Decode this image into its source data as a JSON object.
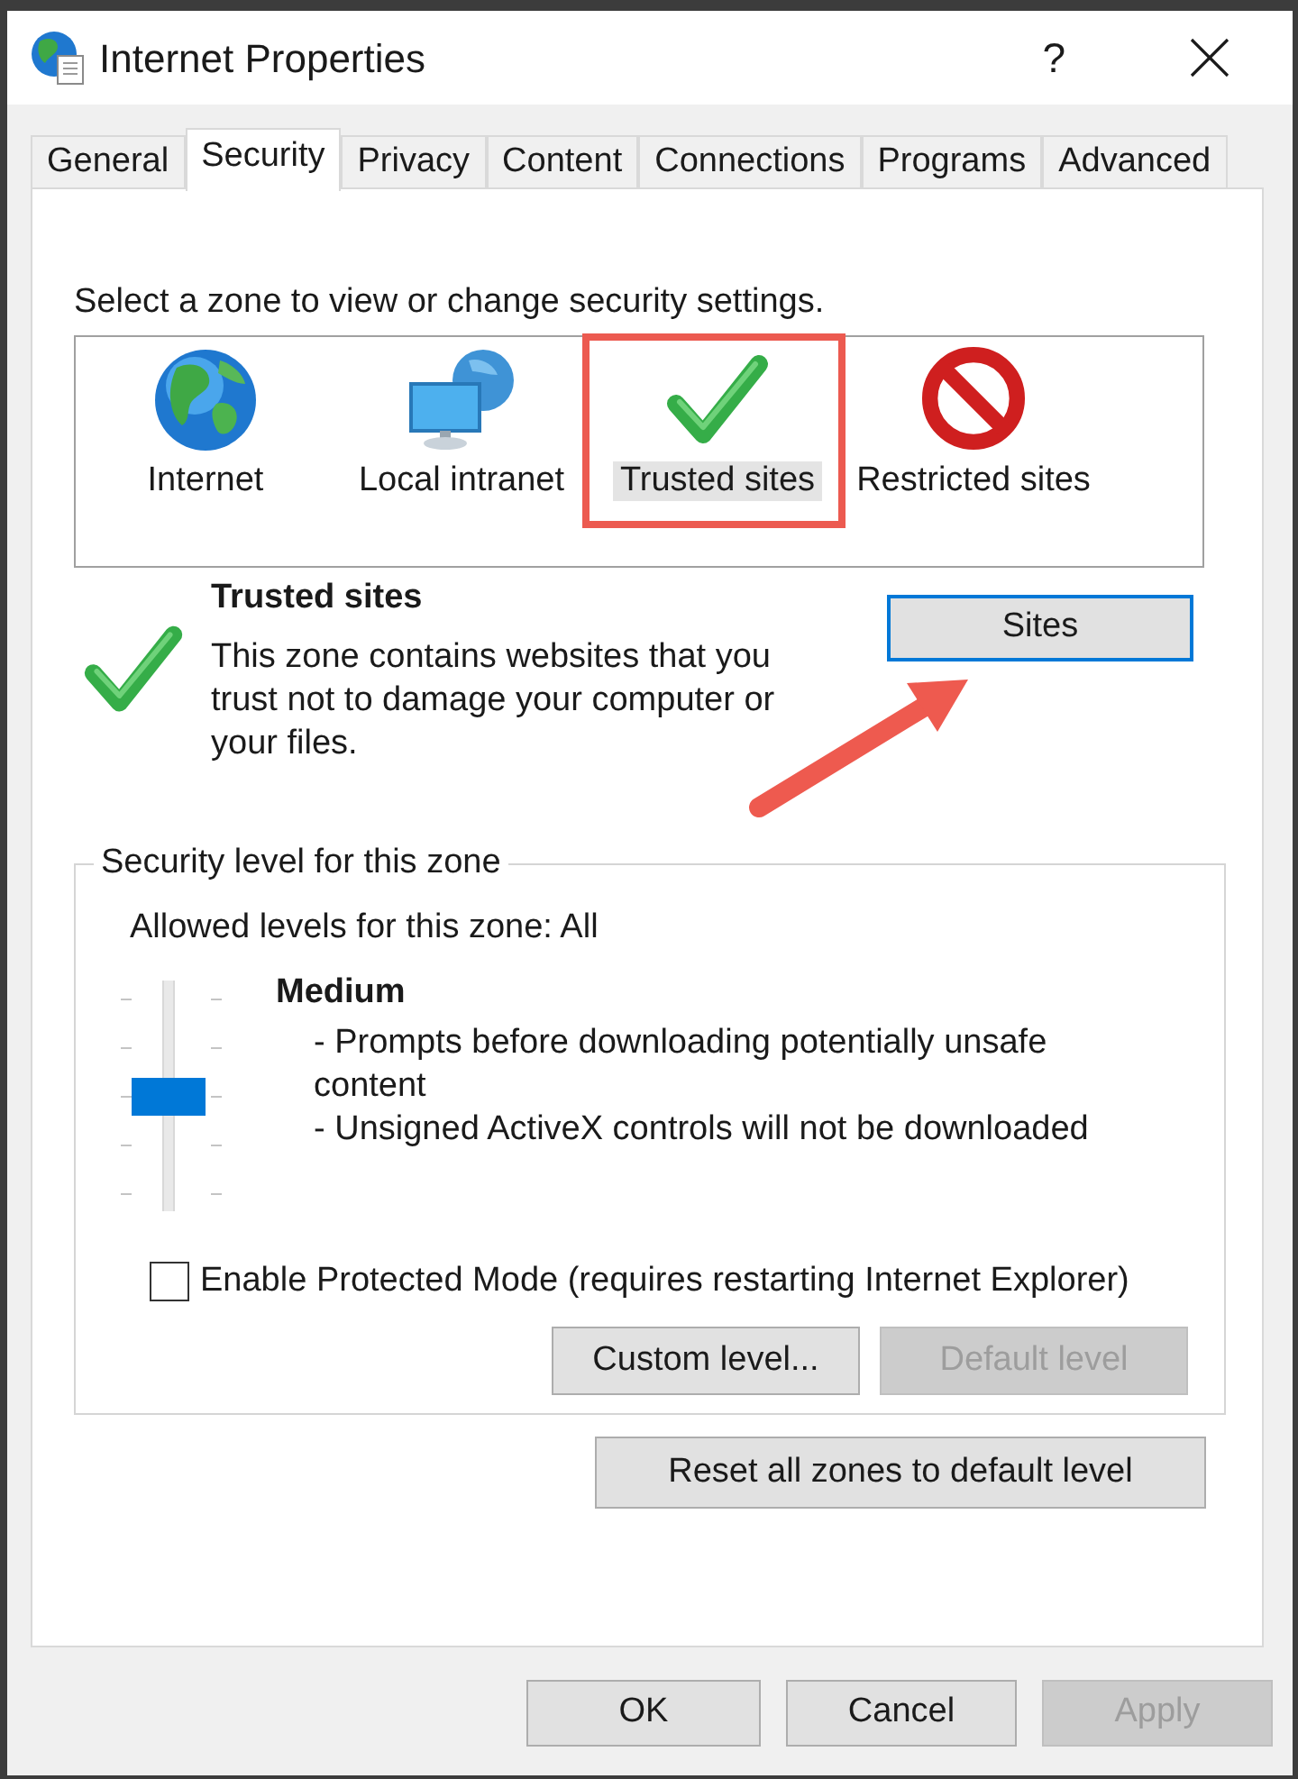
{
  "window": {
    "title": "Internet Properties",
    "help": "?"
  },
  "tabs": [
    {
      "label": "General",
      "selected": false
    },
    {
      "label": "Security",
      "selected": true
    },
    {
      "label": "Privacy",
      "selected": false
    },
    {
      "label": "Content",
      "selected": false
    },
    {
      "label": "Connections",
      "selected": false
    },
    {
      "label": "Programs",
      "selected": false
    },
    {
      "label": "Advanced",
      "selected": false
    }
  ],
  "zone_picker": {
    "prompt": "Select a zone to view or change security settings.",
    "zones": [
      {
        "kind": "internet",
        "label": "Internet",
        "selected": false,
        "callout": false
      },
      {
        "kind": "intranet",
        "label": "Local intranet",
        "selected": false,
        "callout": false
      },
      {
        "kind": "trusted",
        "label": "Trusted sites",
        "selected": true,
        "callout": true
      },
      {
        "kind": "restricted",
        "label": "Restricted sites",
        "selected": false,
        "callout": false
      }
    ]
  },
  "zone_info": {
    "kind": "trusted",
    "title": "Trusted sites",
    "description": "This zone contains websites that you trust not to damage your computer or your files.",
    "sites_button": {
      "label": "Sites",
      "focused": true,
      "callout": true
    }
  },
  "security_level": {
    "legend": "Security level for this zone",
    "allowed": "Allowed levels for this zone: All",
    "slider": {
      "level": 0.5
    },
    "level_name": "Medium",
    "notes": [
      "- Prompts before downloading potentially unsafe content",
      "- Unsigned ActiveX controls will not be downloaded"
    ],
    "protected_mode": {
      "label": "Enable Protected Mode (requires restarting Internet Explorer)",
      "checked": false
    },
    "buttons": [
      {
        "label": "Custom level...",
        "disabled": false
      },
      {
        "label": "Default level",
        "disabled": true
      }
    ]
  },
  "reset_button": {
    "label": "Reset all zones to default level"
  },
  "footer_buttons": [
    {
      "label": "OK",
      "disabled": false
    },
    {
      "label": "Cancel",
      "disabled": false
    },
    {
      "label": "Apply",
      "disabled": true
    }
  ]
}
